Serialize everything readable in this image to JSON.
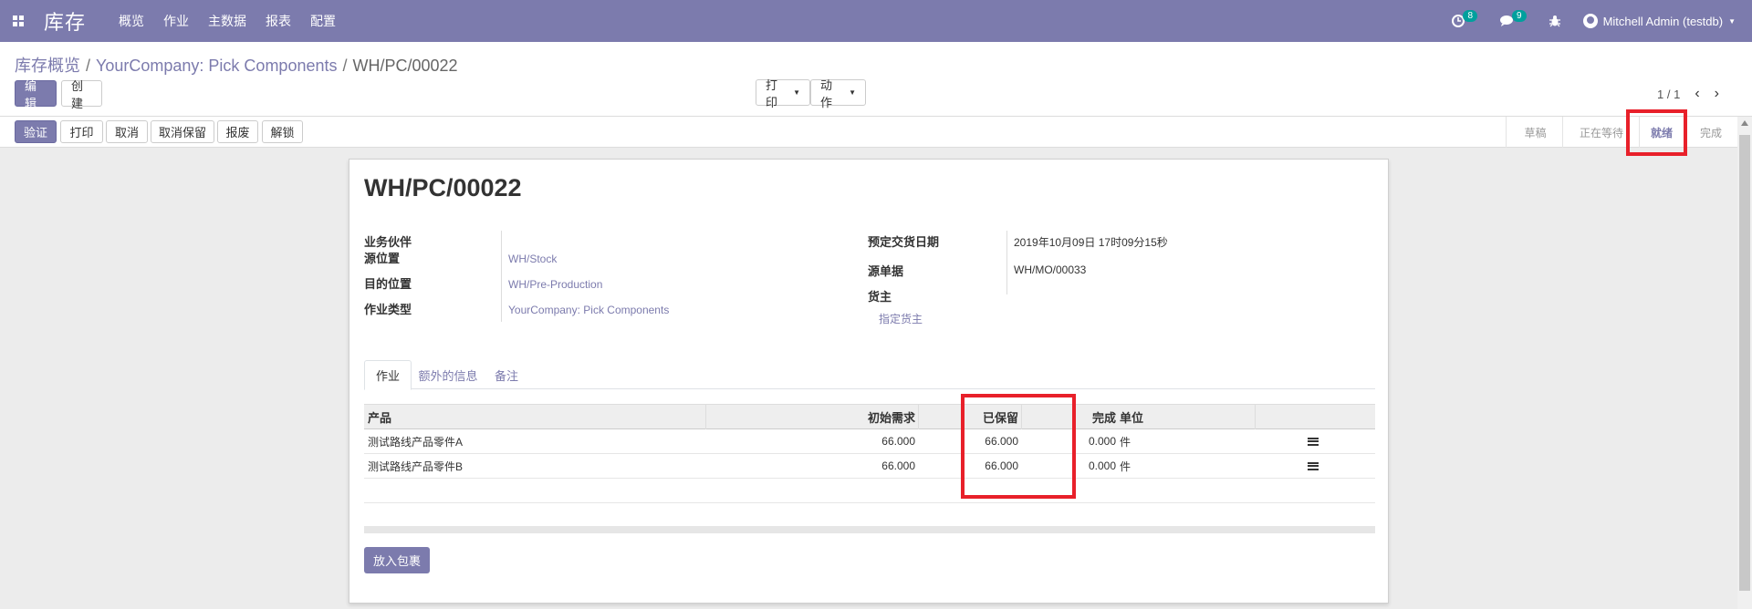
{
  "navbar": {
    "app_name": "库存",
    "menu": [
      "概览",
      "作业",
      "主数据",
      "报表",
      "配置"
    ],
    "activity_count": "8",
    "message_count": "9",
    "user": "Mitchell Admin (testdb)"
  },
  "breadcrumb": {
    "items": [
      "库存概览",
      "YourCompany: Pick Components"
    ],
    "current": "WH/PC/00022"
  },
  "buttons": {
    "edit": "编辑",
    "create": "创建",
    "print_menu": "打印",
    "action_menu": "动作"
  },
  "pager": {
    "value": "1 / 1"
  },
  "statusbar": {
    "actions": [
      "验证",
      "打印",
      "取消",
      "取消保留",
      "报废",
      "解锁"
    ],
    "stages": [
      "草稿",
      "正在等待",
      "就绪",
      "完成"
    ],
    "active_stage": "就绪"
  },
  "form": {
    "title": "WH/PC/00022",
    "left_fields": [
      {
        "label": "业务伙伴",
        "value": ""
      },
      {
        "label": "源位置",
        "value": "WH/Stock"
      },
      {
        "label": "目的位置",
        "value": "WH/Pre-Production"
      },
      {
        "label": "作业类型",
        "value": "YourCompany: Pick Components"
      }
    ],
    "right_fields": [
      {
        "label": "预定交货日期",
        "value": "2019年10月09日 17时09分15秒"
      },
      {
        "label": "源单据",
        "value": "WH/MO/00033"
      },
      {
        "label": "货主",
        "value": "指定货主"
      }
    ],
    "tabs": [
      "作业",
      "额外的信息",
      "备注"
    ],
    "table": {
      "headers": [
        "产品",
        "初始需求",
        "已保留",
        "完成",
        "单位"
      ],
      "rows": [
        {
          "product": "测试路线产品零件A",
          "initial_demand": "66.000",
          "reserved": "66.000",
          "done": "0.000",
          "uom": "件"
        },
        {
          "product": "测试路线产品零件B",
          "initial_demand": "66.000",
          "reserved": "66.000",
          "done": "0.000",
          "uom": "件"
        }
      ]
    },
    "put_in_pack": "放入包裹"
  },
  "colors": {
    "brand": "#7c7bad",
    "highlight": "#e8202a",
    "badge": "#00a09d"
  }
}
